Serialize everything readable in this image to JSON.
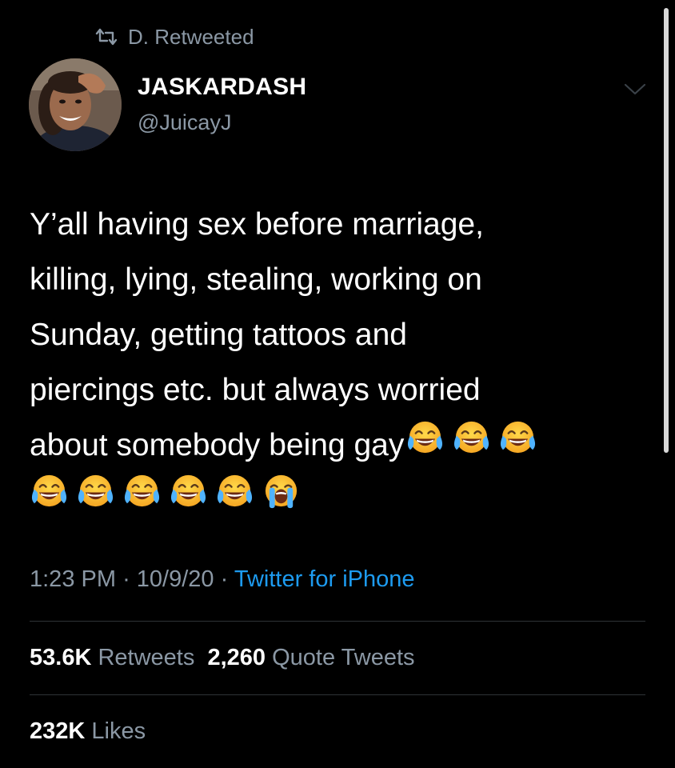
{
  "retweet": {
    "icon": "retweet-icon",
    "label": "D. Retweeted"
  },
  "author": {
    "display_name": "JASKARDASH",
    "handle": "@JuicayJ",
    "avatar": "profile-photo"
  },
  "menu_icon": "chevron-down-icon",
  "tweet": {
    "lines": [
      "Y’all having sex before marriage,",
      "killing, lying, stealing, working on",
      "Sunday, getting tattoos and",
      "piercings etc. but always worried",
      "about somebody being gay"
    ],
    "inline_emojis": [
      "face-with-tears-of-joy",
      "face-with-tears-of-joy",
      "face-with-tears-of-joy"
    ],
    "trailing_emojis": [
      "face-with-tears-of-joy",
      "face-with-tears-of-joy",
      "face-with-tears-of-joy",
      "face-with-tears-of-joy",
      "face-with-tears-of-joy",
      "loudly-crying-face"
    ]
  },
  "meta": {
    "time": "1:23 PM",
    "separator": "·",
    "date": "10/9/20",
    "source": "Twitter for iPhone"
  },
  "stats": {
    "retweets_count": "53.6K",
    "retweets_label": "Retweets",
    "quotes_count": "2,260",
    "quotes_label": "Quote Tweets",
    "likes_count": "232K",
    "likes_label": "Likes"
  },
  "colors": {
    "background": "#000000",
    "text": "#ffffff",
    "secondary_text": "#8b98a5",
    "link": "#1d9bf0",
    "divider": "#2f3336"
  }
}
